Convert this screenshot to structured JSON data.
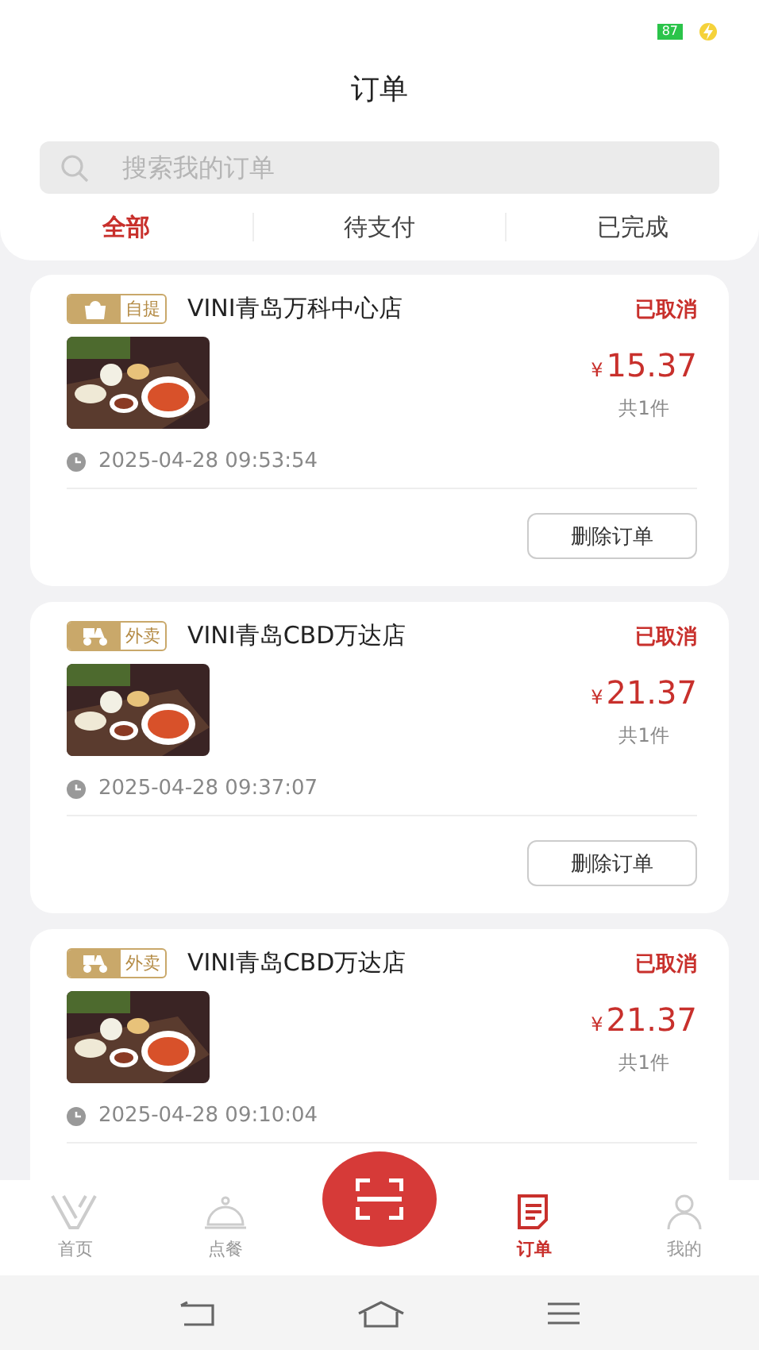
{
  "status_bar": {
    "battery": "87"
  },
  "header": {
    "title": "订单",
    "search": {
      "placeholder": "搜索我的订单"
    },
    "tabs": [
      {
        "label": "全部",
        "selected": true
      },
      {
        "label": "待支付",
        "selected": false
      },
      {
        "label": "已完成",
        "selected": false
      }
    ]
  },
  "orders": [
    {
      "type": {
        "kind": "pickup",
        "label": "自提"
      },
      "store": "VINI青岛万科中心店",
      "status": "已取消",
      "currency": "¥",
      "price": "15.37",
      "count": "共1件",
      "time": "2025-04-28 09:53:54",
      "button": "删除订单"
    },
    {
      "type": {
        "kind": "delivery",
        "label": "外卖"
      },
      "store": "VINI青岛CBD万达店",
      "status": "已取消",
      "currency": "¥",
      "price": "21.37",
      "count": "共1件",
      "time": "2025-04-28 09:37:07",
      "button": "删除订单"
    },
    {
      "type": {
        "kind": "delivery",
        "label": "外卖"
      },
      "store": "VINI青岛CBD万达店",
      "status": "已取消",
      "currency": "¥",
      "price": "21.37",
      "count": "共1件",
      "time": "2025-04-28 09:10:04"
    }
  ],
  "tab_bar": [
    {
      "kind": "home",
      "label": "首页",
      "selected": false
    },
    {
      "kind": "dine",
      "label": "点餐",
      "selected": false
    },
    {
      "kind": "scan",
      "selected": false
    },
    {
      "kind": "orders",
      "label": "订单",
      "selected": true
    },
    {
      "kind": "profile",
      "label": "我的",
      "selected": false
    }
  ]
}
